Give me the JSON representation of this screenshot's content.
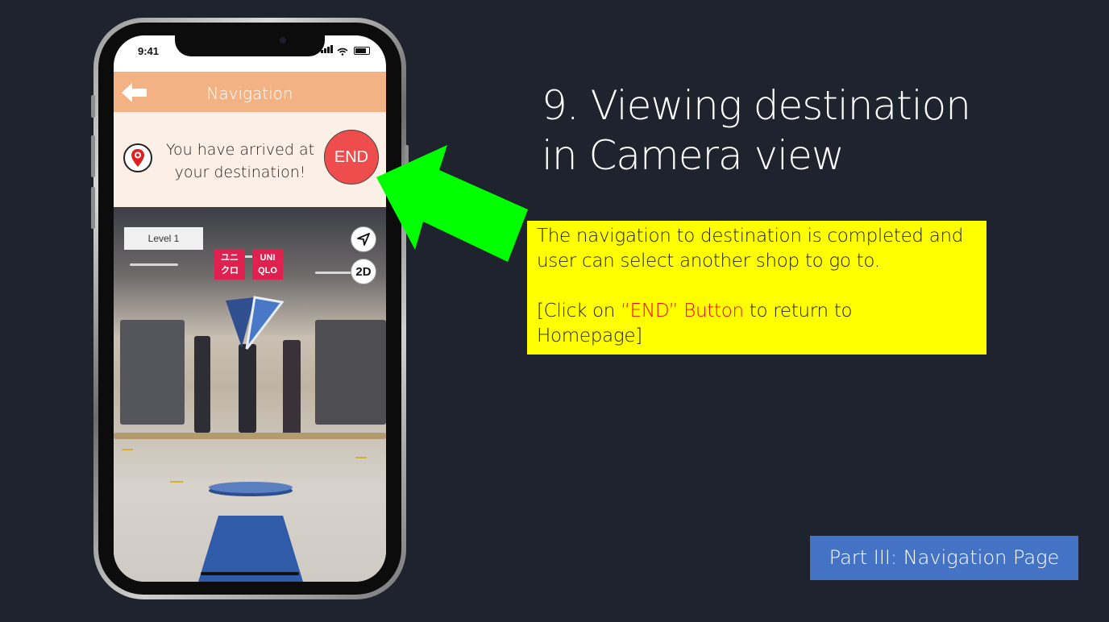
{
  "status_bar": {
    "time": "9:41"
  },
  "header": {
    "title": "Navigation"
  },
  "arrival": {
    "line1": "You have arrived at",
    "line2": "your destination!",
    "end_button": "END"
  },
  "camera_view": {
    "level_label": "Level 1",
    "view_toggle": "2D",
    "store_sign_top": "ユニ",
    "store_sign_bottom": "クロ",
    "store_sign2_top": "UNI",
    "store_sign2_bottom": "QLO"
  },
  "slide": {
    "title_line1": "9. Viewing destination",
    "title_line2": "in Camera view",
    "note_line1": "The navigation to destination is completed and",
    "note_line2": "user can select another shop to go to.",
    "note_line3_prefix": "[Click on ",
    "note_line3_highlight": "“END” Button",
    "note_line3_suffix": " to return to",
    "note_line4": "Homepage]",
    "part_label": "Part III: Navigation Page"
  },
  "colors": {
    "background": "#1f232d",
    "header": "#f3b283",
    "end_button": "#ef4d4d",
    "note_box": "#ffff00",
    "part_box": "#4472c4",
    "arrow": "#00ff00",
    "ar_marker": "#3f64a8"
  },
  "icons": {
    "back": "back-arrow-icon",
    "pin": "location-pin-icon",
    "locate": "navigation-arrow-icon",
    "pointer": "arrow-pointer-icon"
  }
}
